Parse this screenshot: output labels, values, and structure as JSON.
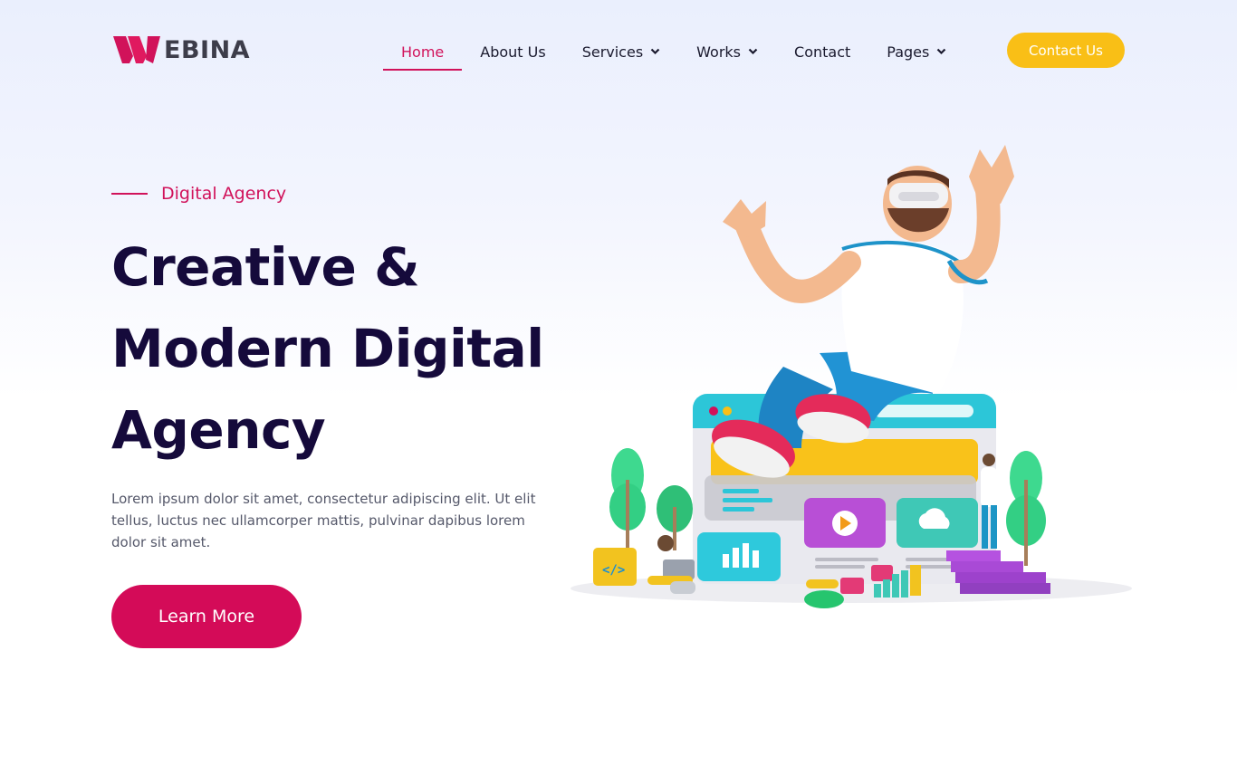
{
  "brand": {
    "logo_text": "EBINA",
    "logo_colors": {
      "mark": "#d1125a",
      "text": "#3d3d4a"
    }
  },
  "nav": {
    "items": [
      {
        "label": "Home",
        "active": true,
        "dropdown": false
      },
      {
        "label": "About Us",
        "active": false,
        "dropdown": false
      },
      {
        "label": "Services",
        "active": false,
        "dropdown": true
      },
      {
        "label": "Works",
        "active": false,
        "dropdown": true
      },
      {
        "label": "Contact",
        "active": false,
        "dropdown": false
      },
      {
        "label": "Pages",
        "active": false,
        "dropdown": true
      }
    ],
    "cta_label": "Contact Us"
  },
  "hero": {
    "eyebrow": "Digital Agency",
    "title_lines": [
      "Creative &",
      "Modern Digital",
      "Agency"
    ],
    "description": "Lorem ipsum dolor sit amet, consectetur adipiscing elit. Ut elit tellus, luctus nec ullamcorper mattis, pulvinar dapibus lorem dolor sit amet.",
    "button_label": "Learn More",
    "illustration_icon": "vr-man-sitting-on-browser-window-illustration"
  },
  "colors": {
    "accent": "#d1125a",
    "cta": "#f9bf16",
    "heading": "#150a3b",
    "body_text": "#55586a"
  }
}
